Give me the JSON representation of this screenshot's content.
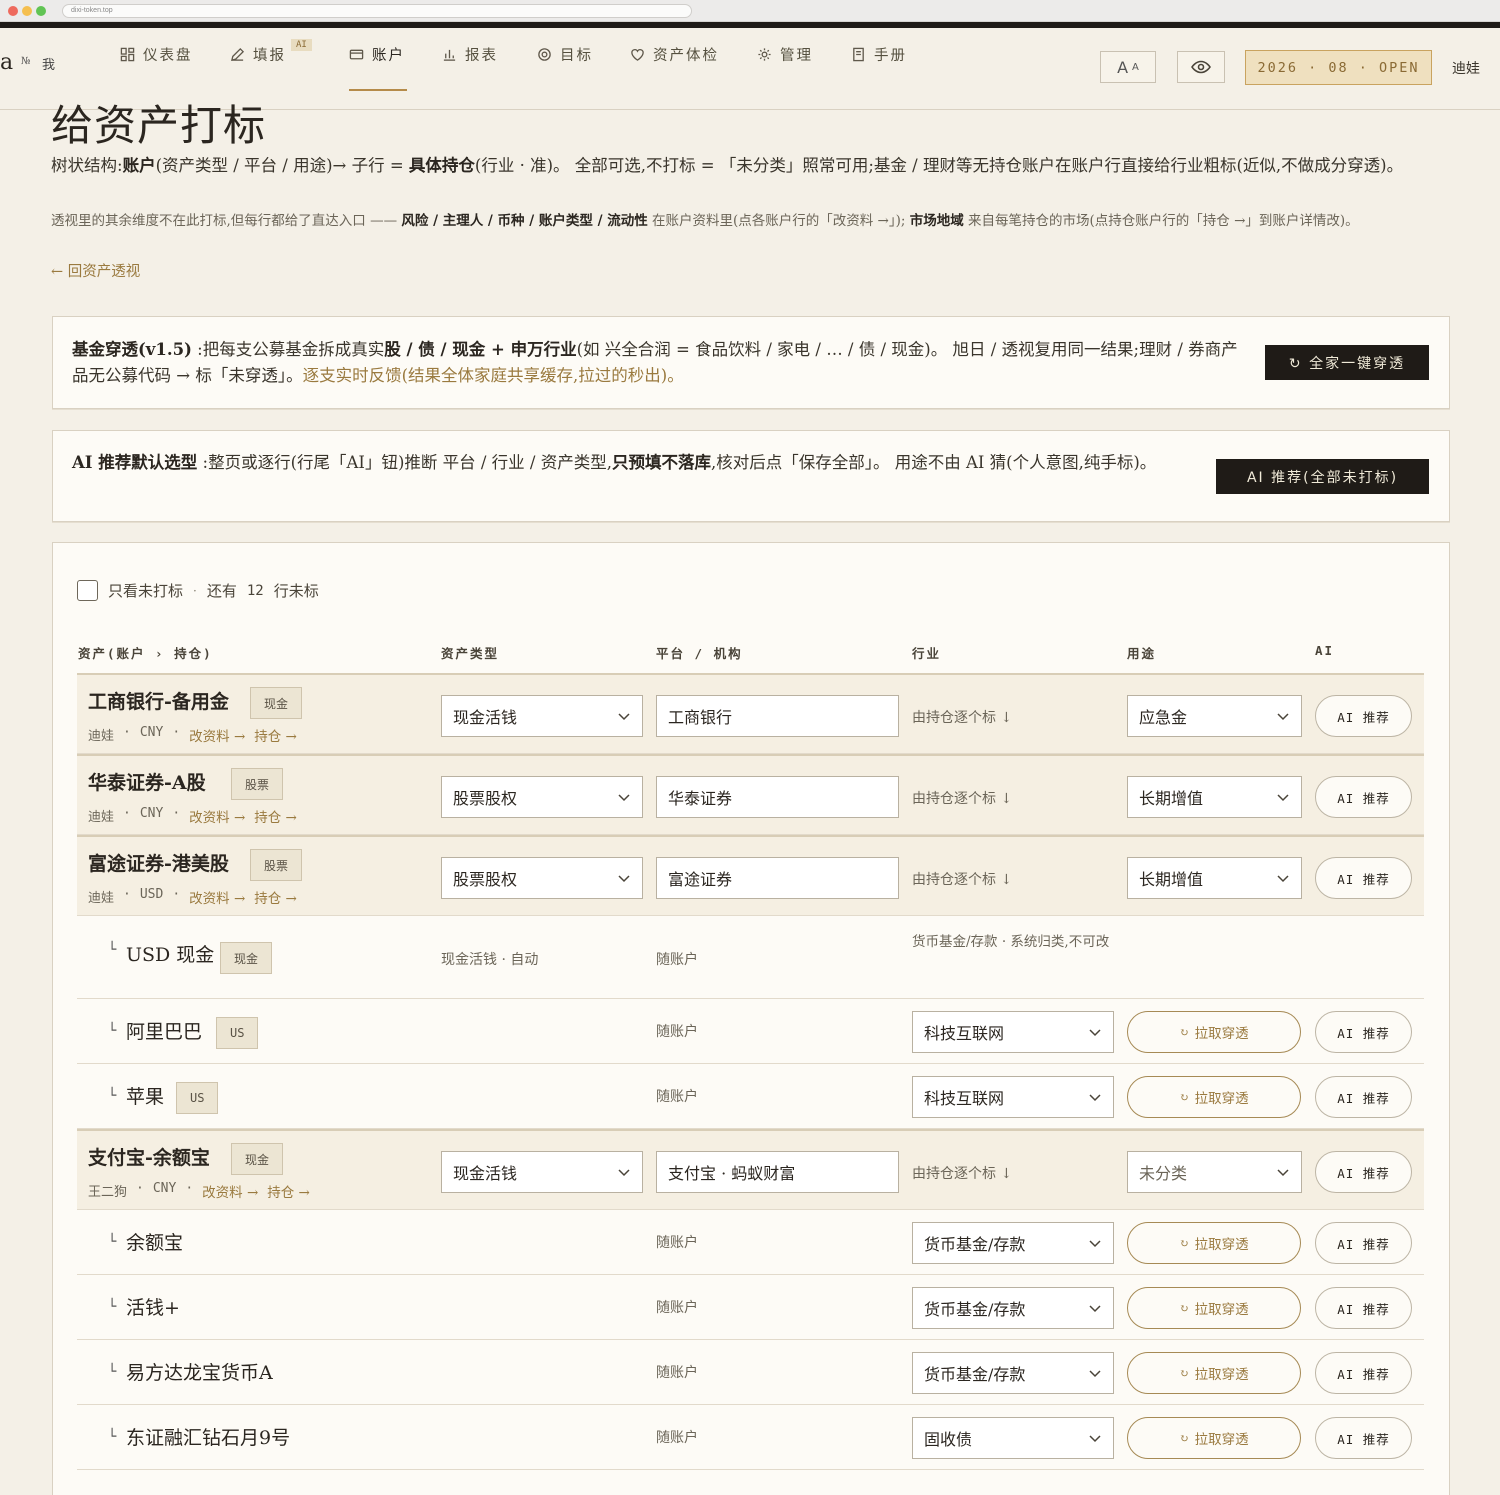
{
  "browser": {
    "url": "dixi-token.top"
  },
  "brand": {
    "letter": "a",
    "small": "№",
    "me": "我"
  },
  "nav": {
    "items": [
      {
        "label": "仪表盘",
        "icon": "dashboard-icon"
      },
      {
        "label": "填报",
        "icon": "pen-icon",
        "badge": "AI"
      },
      {
        "label": "账户",
        "icon": "card-icon",
        "active": true
      },
      {
        "label": "报表",
        "icon": "chart-icon"
      },
      {
        "label": "目标",
        "icon": "target-icon"
      },
      {
        "label": "资产体检",
        "icon": "heart-icon"
      },
      {
        "label": "管理",
        "icon": "gear-icon"
      },
      {
        "label": "手册",
        "icon": "book-icon"
      }
    ],
    "font_big": "A",
    "font_small": "A",
    "period": "2026 · 08 · OPEN",
    "user": "迪娃"
  },
  "page": {
    "title": "给资产打标",
    "lead_1": "树状结构:",
    "lead_b1": "账户",
    "lead_2": "(资产类型 / 平台 / 用途)→ 子行 = ",
    "lead_b2": "具体持仓",
    "lead_3": "(行业 · 准)。 全部可选,不打标 = 「未分类」照常可用;基金 / 理财等无持仓账户在账户行直接给行业粗标(近似,不做成分穿透)。",
    "sub_1": "透视里的其余维度不在此打标,但每行都给了直达入口 —— ",
    "sub_b1": "风险 / 主理人 / 币种 / 账户类型 / 流动性",
    "sub_2": " 在账户资料里(点各账户行的「改资料 →」); ",
    "sub_b2": "市场地域",
    "sub_3": " 来自每笔持仓的市场(点持仓账户行的「持仓 →」到账户详情改)。",
    "back": "← 回资产透视"
  },
  "fund_card": {
    "b1": "基金穿透(v1.5)",
    "t1": " :把每支公募基金拆成真实",
    "b2": "股 / 债 / 现金 + 申万行业",
    "t2": "(如 兴全合润 = 食品饮料 / 家电 / … / 债 / 现金)。 旭日 / 透视复用同一结果;理财 / 券商产品无公募代码 → 标「未穿透」。",
    "hl": "逐支实时反馈(结果全体家庭共享缓存,拉过的秒出)。",
    "button": "↻ 全家一键穿透"
  },
  "ai_card": {
    "b1": "AI 推荐默认选型",
    "t1": " :整页或逐行(行尾「AI」钮)推断 平台 / 行业 / 资产类型,",
    "b2": "只预填不落库",
    "t2": ",核对后点「保存全部」。 用途不由 AI 猜(个人意图,纯手标)。",
    "button": "AI 推荐(全部未打标)"
  },
  "table": {
    "filter_label": "只看未打标",
    "filter_sep": "·",
    "remain_prefix": "还有",
    "remain_count": "12",
    "remain_suffix": "行未标",
    "headers": [
      "资产(账户 › 持仓)",
      "资产类型",
      "平台 / 机构",
      "行业",
      "用途",
      "AI"
    ],
    "ai_label": "AI 推荐",
    "pull_label": "拉取穿透",
    "branch": "└",
    "edit_link": "改资料 →",
    "hold_link": "持仓 →",
    "by_holding": "由持仓逐个标 ↓",
    "follow_account": "随账户",
    "rows": [
      {
        "kind": "acct",
        "name": "工商银行-备用金",
        "tag": "现金",
        "owner": "迪娃",
        "ccy": "CNY",
        "asset_type": "现金活钱",
        "platform": "工商银行",
        "usage": "应急金"
      },
      {
        "kind": "acct",
        "name": "华泰证券-A股",
        "tag": "股票",
        "owner": "迪娃",
        "ccy": "CNY",
        "asset_type": "股票股权",
        "platform": "华泰证券",
        "usage": "长期增值"
      },
      {
        "kind": "acct",
        "name": "富途证券-港美股",
        "tag": "股票",
        "owner": "迪娃",
        "ccy": "USD",
        "asset_type": "股票股权",
        "platform": "富途证券",
        "usage": "长期增值"
      },
      {
        "kind": "cash",
        "name": "USD 现金",
        "tag": "现金",
        "asset_type": "现金活钱 · 自动",
        "industry_note": "货币基金/存款 · 系统归类,不可改"
      },
      {
        "kind": "hold",
        "name": "阿里巴巴",
        "tag": "US",
        "industry": "科技互联网"
      },
      {
        "kind": "hold",
        "name": "苹果",
        "tag": "US",
        "industry": "科技互联网"
      },
      {
        "kind": "acct",
        "name": "支付宝-余额宝",
        "tag": "现金",
        "owner": "王二狗",
        "ccy": "CNY",
        "asset_type": "现金活钱",
        "platform": "支付宝 · 蚂蚁财富",
        "usage": "未分类"
      },
      {
        "kind": "hold",
        "name": "余额宝",
        "industry": "货币基金/存款"
      },
      {
        "kind": "hold",
        "name": "活钱+",
        "industry": "货币基金/存款"
      },
      {
        "kind": "hold",
        "name": "易方达龙宝货币A",
        "industry": "货币基金/存款"
      },
      {
        "kind": "hold",
        "name": "东证融汇钻石月9号",
        "industry": "固收债"
      }
    ]
  },
  "colors": {
    "accent": "#9a7a3f",
    "dark": "#1f1b17",
    "background": "#f4f0e7",
    "account_row": "#f5efe2"
  }
}
